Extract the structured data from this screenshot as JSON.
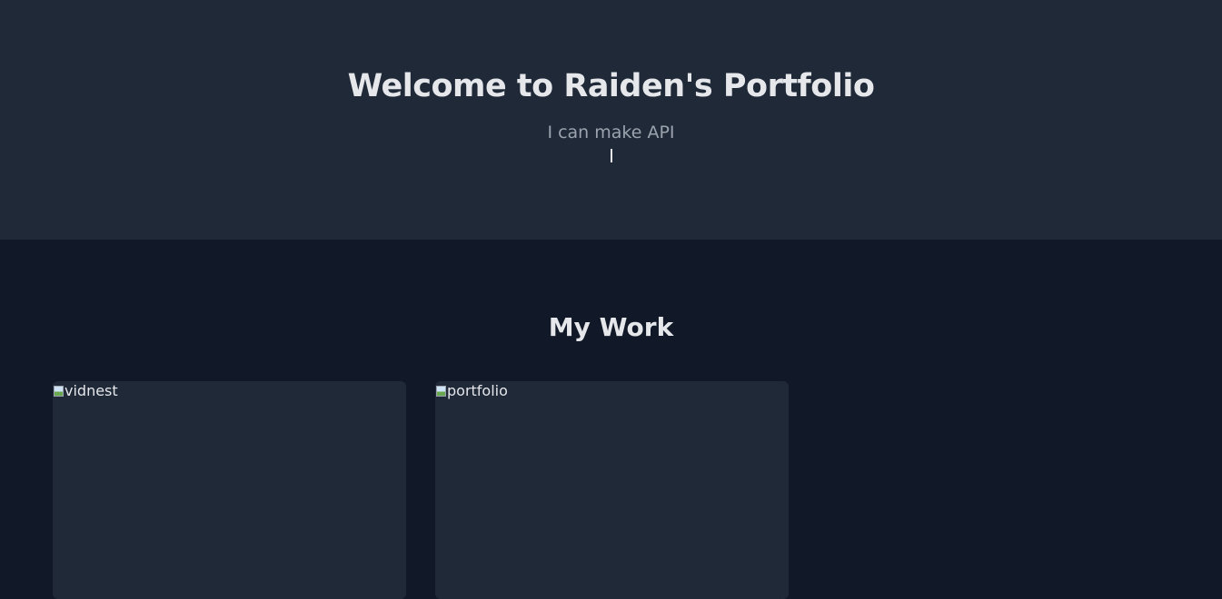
{
  "hero": {
    "title": "Welcome to Raiden's Portfolio",
    "subtitle": "I can make API"
  },
  "work": {
    "title": "My Work",
    "projects": [
      {
        "alt": "vidnest"
      },
      {
        "alt": "portfolio"
      }
    ]
  },
  "colors": {
    "hero_bg": "#1f2937",
    "page_bg": "#111827",
    "card_bg": "#1f2937",
    "text_primary": "#e5e7eb",
    "text_muted": "#9ca3af"
  }
}
